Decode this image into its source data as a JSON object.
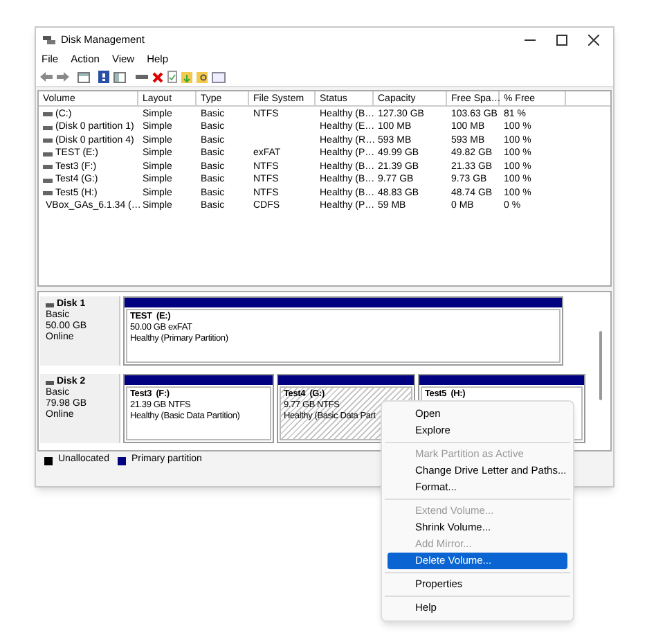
{
  "window": {
    "title": "Disk Management"
  },
  "menu_bar": [
    "File",
    "Action",
    "View",
    "Help"
  ],
  "volume_table": {
    "columns": [
      "Volume",
      "Layout",
      "Type",
      "File System",
      "Status",
      "Capacity",
      "Free Spa…",
      "% Free"
    ],
    "rows": [
      {
        "kind": "drive",
        "cells": [
          "(C:)",
          "Simple",
          "Basic",
          "NTFS",
          "Healthy (B…",
          "127.30 GB",
          "103.63 GB",
          "81 %"
        ]
      },
      {
        "kind": "drive",
        "cells": [
          "(Disk 0 partition 1)",
          "Simple",
          "Basic",
          "",
          "Healthy (E…",
          "100 MB",
          "100 MB",
          "100 %"
        ]
      },
      {
        "kind": "drive",
        "cells": [
          "(Disk 0 partition 4)",
          "Simple",
          "Basic",
          "",
          "Healthy (R…",
          "593 MB",
          "593 MB",
          "100 %"
        ]
      },
      {
        "kind": "drive",
        "cells": [
          "TEST (E:)",
          "Simple",
          "Basic",
          "exFAT",
          "Healthy (P…",
          "49.99 GB",
          "49.82 GB",
          "100 %"
        ]
      },
      {
        "kind": "drive",
        "cells": [
          "Test3 (F:)",
          "Simple",
          "Basic",
          "NTFS",
          "Healthy (B…",
          "21.39 GB",
          "21.33 GB",
          "100 %"
        ]
      },
      {
        "kind": "drive",
        "cells": [
          "Test4 (G:)",
          "Simple",
          "Basic",
          "NTFS",
          "Healthy (B…",
          "9.77 GB",
          "9.73 GB",
          "100 %"
        ]
      },
      {
        "kind": "drive",
        "cells": [
          "Test5 (H:)",
          "Simple",
          "Basic",
          "NTFS",
          "Healthy (B…",
          "48.83 GB",
          "48.74 GB",
          "100 %"
        ]
      },
      {
        "kind": "cd",
        "cells": [
          "VBox_GAs_6.1.34 (…",
          "Simple",
          "Basic",
          "CDFS",
          "Healthy (P…",
          "59 MB",
          "0 MB",
          "0 %"
        ]
      }
    ]
  },
  "disks": [
    {
      "name": "Disk 1",
      "type": "Basic",
      "size": "50.00 GB",
      "state": "Online",
      "partitions": [
        {
          "name": "TEST  (E:)",
          "info": "50.00 GB exFAT",
          "status": "Healthy (Primary Partition)",
          "selected": false
        }
      ]
    },
    {
      "name": "Disk 2",
      "type": "Basic",
      "size": "79.98 GB",
      "state": "Online",
      "partitions": [
        {
          "name": "Test3  (F:)",
          "info": "21.39 GB NTFS",
          "status": "Healthy (Basic Data Partition)",
          "selected": false
        },
        {
          "name": "Test4  (G:)",
          "info": "9.77 GB NTFS",
          "status": "Healthy (Basic Data Part",
          "selected": true
        },
        {
          "name": "Test5  (H:)",
          "selected": false
        }
      ]
    }
  ],
  "legend": [
    {
      "label": "Unallocated",
      "color": "#000000"
    },
    {
      "label": "Primary partition",
      "color": "#000080"
    }
  ],
  "context_menu": [
    {
      "kind": "item",
      "label": "Open",
      "disabled": false,
      "selected": false
    },
    {
      "kind": "item",
      "label": "Explore",
      "disabled": false,
      "selected": false
    },
    {
      "kind": "separator"
    },
    {
      "kind": "item",
      "label": "Mark Partition as Active",
      "disabled": true,
      "selected": false
    },
    {
      "kind": "item",
      "label": "Change Drive Letter and Paths...",
      "disabled": false,
      "selected": false
    },
    {
      "kind": "item",
      "label": "Format...",
      "disabled": false,
      "selected": false
    },
    {
      "kind": "separator"
    },
    {
      "kind": "item",
      "label": "Extend Volume...",
      "disabled": true,
      "selected": false
    },
    {
      "kind": "item",
      "label": "Shrink Volume...",
      "disabled": false,
      "selected": false
    },
    {
      "kind": "item",
      "label": "Add Mirror...",
      "disabled": true,
      "selected": false
    },
    {
      "kind": "item",
      "label": "Delete Volume...",
      "disabled": false,
      "selected": true
    },
    {
      "kind": "separator"
    },
    {
      "kind": "item",
      "label": "Properties",
      "disabled": false,
      "selected": false
    },
    {
      "kind": "separator"
    },
    {
      "kind": "item",
      "label": "Help",
      "disabled": false,
      "selected": false
    }
  ]
}
